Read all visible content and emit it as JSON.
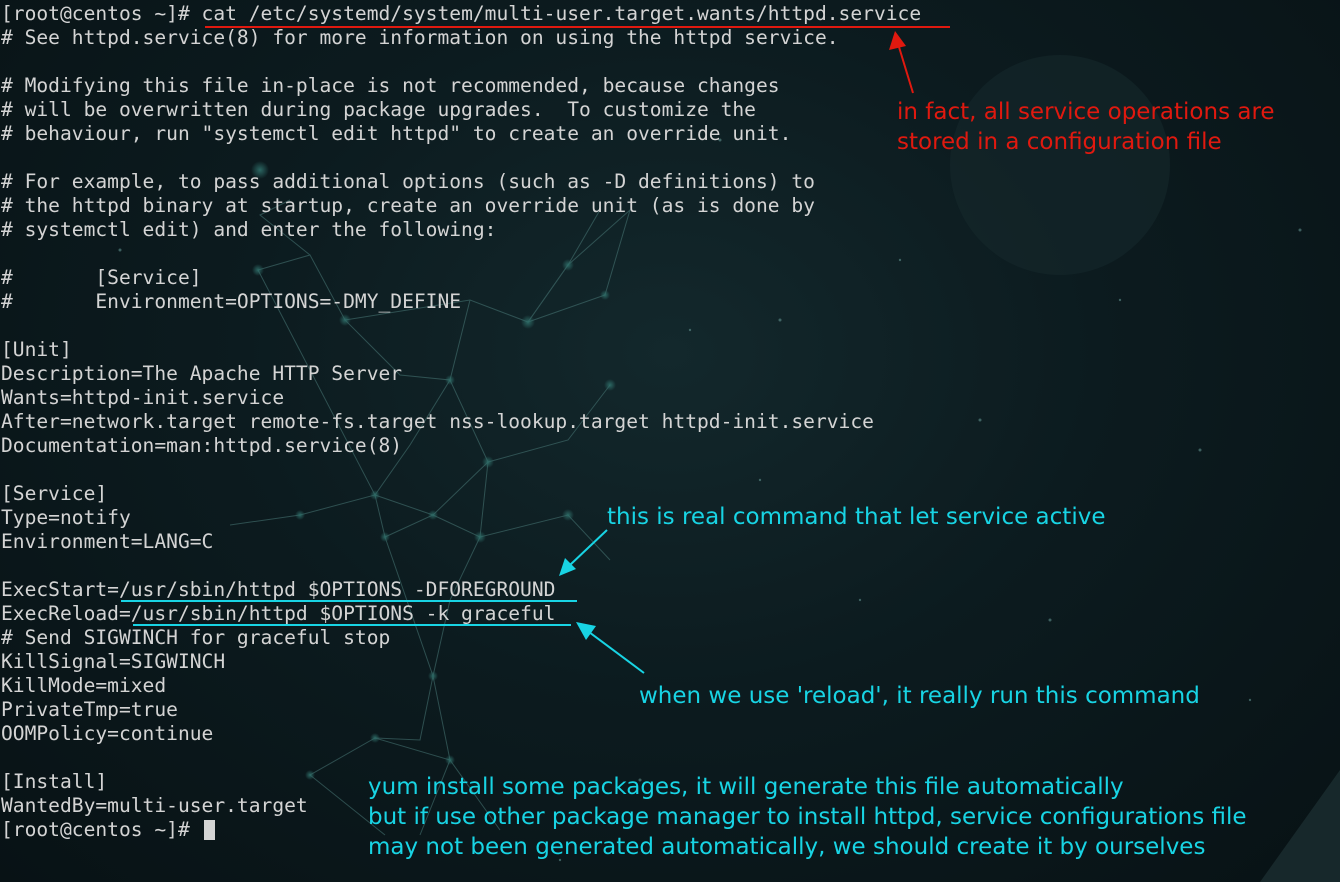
{
  "terminal": {
    "prompt": "[root@centos ~]# ",
    "command": "cat /etc/systemd/system/multi-user.target.wants/httpd.service",
    "lines": [
      "# See httpd.service(8) for more information on using the httpd service.",
      "",
      "# Modifying this file in-place is not recommended, because changes",
      "# will be overwritten during package upgrades.  To customize the",
      "# behaviour, run \"systemctl edit httpd\" to create an override unit.",
      "",
      "# For example, to pass additional options (such as -D definitions) to",
      "# the httpd binary at startup, create an override unit (as is done by",
      "# systemctl edit) and enter the following:",
      "",
      "#       [Service]",
      "#       Environment=OPTIONS=-DMY_DEFINE",
      "",
      "[Unit]",
      "Description=The Apache HTTP Server",
      "Wants=httpd-init.service",
      "After=network.target remote-fs.target nss-lookup.target httpd-init.service",
      "Documentation=man:httpd.service(8)",
      "",
      "[Service]",
      "Type=notify",
      "Environment=LANG=C",
      "",
      "ExecStart=/usr/sbin/httpd $OPTIONS -DFOREGROUND",
      "ExecReload=/usr/sbin/httpd $OPTIONS -k graceful",
      "# Send SIGWINCH for graceful stop",
      "KillSignal=SIGWINCH",
      "KillMode=mixed",
      "PrivateTmp=true",
      "OOMPolicy=continue",
      "",
      "[Install]",
      "WantedBy=multi-user.target"
    ]
  },
  "annotations": {
    "config_file": [
      "in fact, all service operations are",
      "stored in a configuration file"
    ],
    "exec_start": [
      "this is real command that let service active"
    ],
    "exec_reload": [
      "when we use 'reload', it really run this command"
    ],
    "install_note": [
      "yum install some packages, it will generate this file automatically",
      "but if use other package manager to install httpd, service configurations file",
      "may not been generated automatically, we should create it by ourselves"
    ]
  },
  "colors": {
    "terminal_text": "#d4d4d4",
    "background": "#0c1b1f",
    "annotation_red": "#e0190f",
    "annotation_cyan": "#18d4e4"
  }
}
